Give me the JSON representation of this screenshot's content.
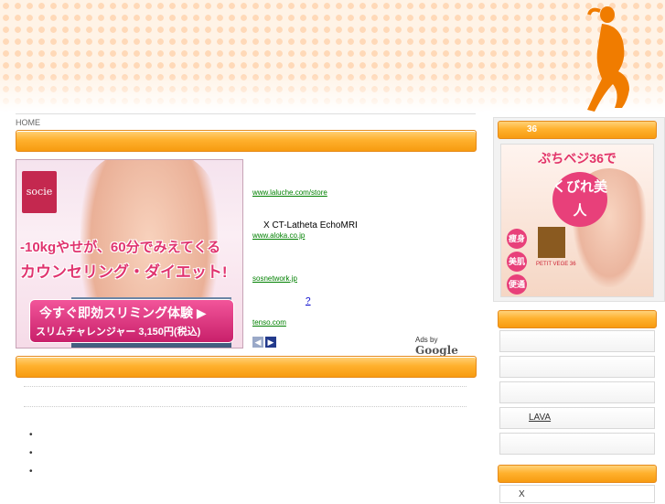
{
  "breadcrumb": {
    "home": "HOME"
  },
  "banner": {
    "brand": "socie",
    "line1": "-10kgやせが、60分でみえてくる",
    "line2": "カウンセリング・ダイエット!",
    "cta1": "今すぐ即効スリミング体験 ▶",
    "cta2": "スリムチャレンジャー 3,150円(税込)"
  },
  "ads": [
    {
      "title": "",
      "desc": "",
      "url": "www.laluche.com/store"
    },
    {
      "title": "",
      "desc": "X CT-Latheta        EchoMRI",
      "url": "www.aloka.co.jp"
    },
    {
      "title": "",
      "desc": "",
      "url": "sosnetwork.jp"
    },
    {
      "title": "?",
      "desc": "",
      "url": "tenso.com"
    }
  ],
  "ads_footer": {
    "prev": "◀",
    "next": "▶",
    "ads_by": "Ads by",
    "google": "Google"
  },
  "bullets": [
    "•",
    "•",
    "•"
  ],
  "sidebar": {
    "top_title": "36",
    "promo": {
      "headline": "ぷちベジ36で",
      "badge": "くびれ美人",
      "points": [
        "瘦身",
        "美肌",
        "便通"
      ],
      "product": "PETIT VEGE 36"
    },
    "menu": [
      "",
      "",
      "",
      "LAVA",
      ""
    ],
    "bottom_item": "X"
  },
  "colors": {
    "accent_orange": "#f79b10",
    "pink": "#e8407a",
    "link": "#0000cc",
    "url_green": "#008000"
  }
}
